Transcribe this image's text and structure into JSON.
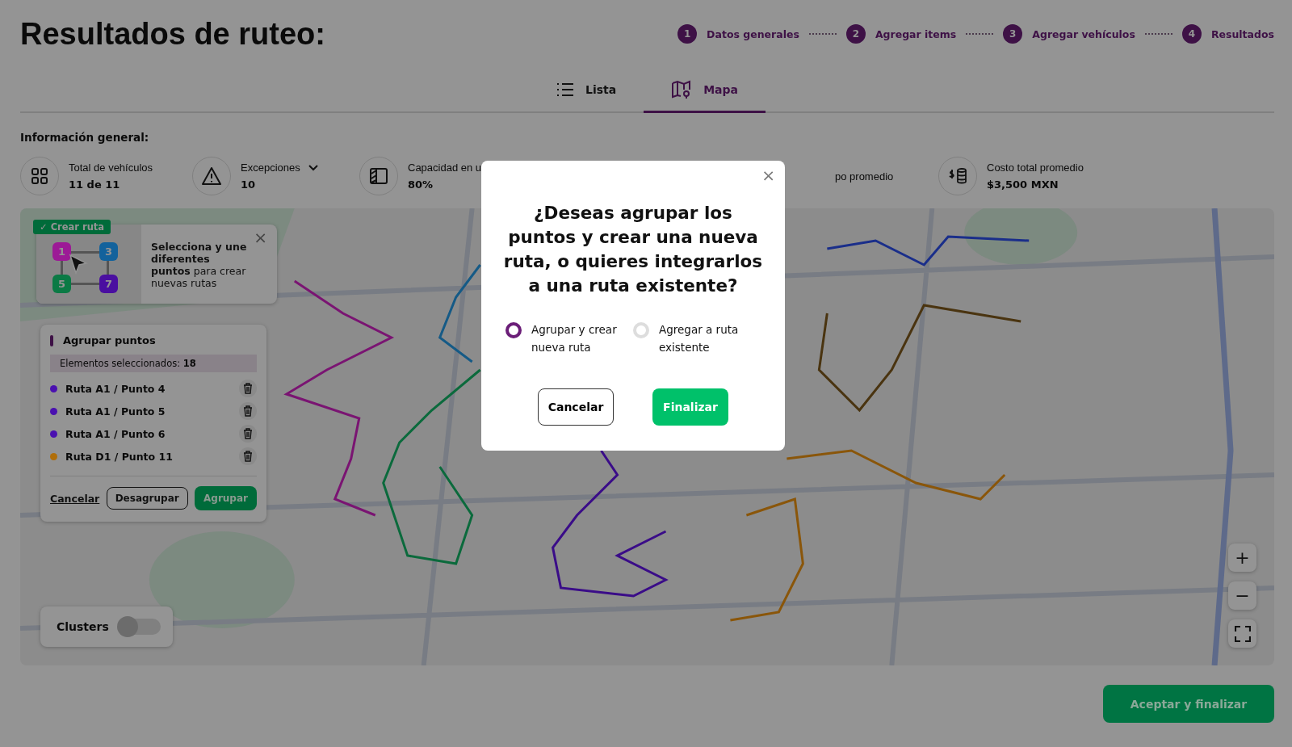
{
  "page_title": "Resultados de ruteo:",
  "stepper": [
    {
      "number": "1",
      "label": "Datos generales"
    },
    {
      "number": "2",
      "label": "Agregar items"
    },
    {
      "number": "3",
      "label": "Agregar vehículos"
    },
    {
      "number": "4",
      "label": "Resultados"
    }
  ],
  "tabs": [
    {
      "label": "Lista",
      "kind": "list",
      "selected": false
    },
    {
      "label": "Mapa",
      "kind": "map",
      "selected": true
    }
  ],
  "info": {
    "heading": "Información general:",
    "stats": [
      {
        "kind": "grid",
        "label": "Total de vehículos",
        "value": "11 de 11",
        "dropdown": false
      },
      {
        "kind": "warning",
        "label": "Excepciones",
        "value": "10",
        "dropdown": true
      },
      {
        "kind": "panel",
        "label": "Capacidad en u",
        "value": "80%",
        "dropdown": false
      },
      {
        "kind": "plain",
        "label": "po promedio",
        "dropdown": false
      },
      {
        "kind": "coins",
        "label": "Costo total promedio",
        "value": "$3,500 MXN",
        "dropdown": false
      }
    ]
  },
  "map": {
    "kind": "picture",
    "create_route_tip": {
      "badge": "✓ Crear ruta",
      "markers": [
        {
          "number": "1",
          "color": "#9c1a96"
        },
        {
          "number": "3",
          "color": "#13629c"
        },
        {
          "number": "5",
          "color": "#0b7a45"
        },
        {
          "number": "7",
          "color": "#4a0fa0"
        }
      ],
      "text": "**Selecciona y une diferentes puntos** para crear nuevas rutas",
      "close": "×"
    },
    "group_panel": {
      "title": "Agrupar puntos",
      "selected_label": "Elementos seleccionados:",
      "selected_count": "18",
      "items": [
        {
          "label": "Ruta A1 / Punto 4",
          "color": "#4a10b0"
        },
        {
          "label": "Ruta A1 / Punto 5",
          "color": "#4a10b0"
        },
        {
          "label": "Ruta A1 / Punto 6",
          "color": "#4a10b0"
        },
        {
          "label": "Ruta D1 / Punto 11",
          "color": "#b06e0a"
        }
      ],
      "cancel": "Cancelar",
      "ungroup": "Desagrupar",
      "group": "Agrupar"
    },
    "clusters": {
      "label": "Clusters",
      "on": false
    },
    "zoom_in": "+",
    "zoom_out": "−"
  },
  "modal": {
    "close": "×",
    "question": "¿Deseas agrupar los puntos y crear una nueva ruta, o quieres integrarlos a una ruta existente?",
    "options": [
      {
        "label": "Agrupar y crear nueva ruta",
        "selected": true
      },
      {
        "label": "Agregar a ruta existente",
        "selected": false
      }
    ],
    "cancel": "Cancelar",
    "confirm": "Finalizar"
  },
  "accept_button": "Aceptar y finalizar"
}
